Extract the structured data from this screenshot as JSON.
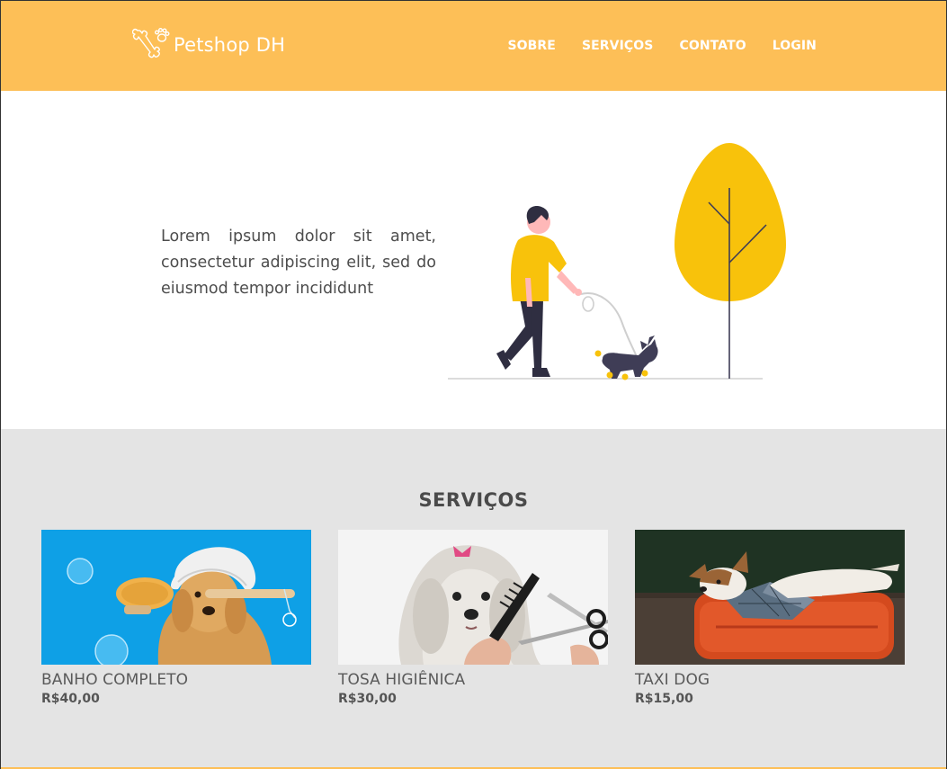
{
  "header": {
    "logo_text": "Petshop DH",
    "nav": [
      {
        "label": "SOBRE"
      },
      {
        "label": "SERVIÇOS"
      },
      {
        "label": "CONTATO"
      },
      {
        "label": "LOGIN"
      }
    ]
  },
  "hero": {
    "text": "Lorem ipsum dolor sit amet, consectetur adipiscing elit, sed do eiusmod tempor incididunt"
  },
  "services": {
    "title": "SERVIÇOS",
    "items": [
      {
        "name": "BANHO COMPLETO",
        "price": "R$40,00",
        "image": "dog-bath-photo"
      },
      {
        "name": "TOSA HIGIÊNICA",
        "price": "R$30,00",
        "image": "dog-grooming-photo"
      },
      {
        "name": "TAXI DOG",
        "price": "R$15,00",
        "image": "dog-on-suitcase-photo"
      }
    ]
  },
  "colors": {
    "brand": "#fdbf57",
    "services_bg": "#e4e4e4",
    "illustration_yellow": "#f8c20b"
  }
}
